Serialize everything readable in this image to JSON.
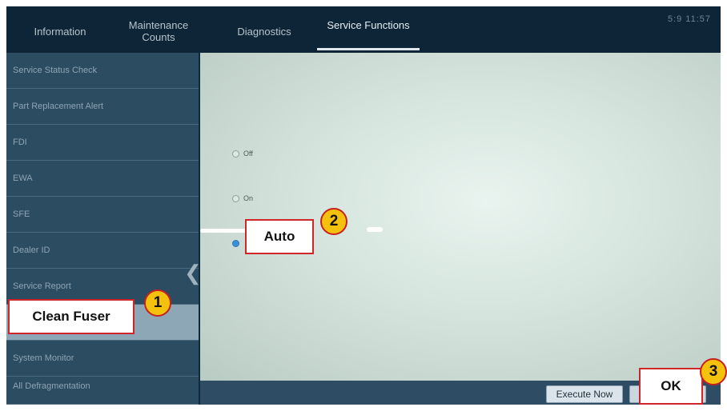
{
  "tabs": [
    {
      "label": "Information",
      "active": false
    },
    {
      "label": "Maintenance Counts",
      "active": false
    },
    {
      "label": "Diagnostics",
      "active": false
    },
    {
      "label": "Service Functions",
      "active": true
    }
  ],
  "clock": "5:9 11:57",
  "sidebar": {
    "items": [
      {
        "label": "Service Status Check",
        "selected": false
      },
      {
        "label": "Part Replacement Alert",
        "selected": false
      },
      {
        "label": "FDI",
        "selected": false
      },
      {
        "label": "EWA",
        "selected": false
      },
      {
        "label": "SFE",
        "selected": false
      },
      {
        "label": "Dealer ID",
        "selected": false
      },
      {
        "label": "Service Report",
        "selected": false
      },
      {
        "label": "Clean Fuser",
        "selected": true
      },
      {
        "label": "System Monitor",
        "selected": false
      },
      {
        "label": "All Defragmentation",
        "selected": false
      }
    ]
  },
  "options": [
    {
      "label": "Off",
      "checked": false
    },
    {
      "label": "On",
      "checked": false
    },
    {
      "label": "Auto",
      "checked": true
    }
  ],
  "buttons": {
    "execute_now": "Execute Now",
    "ok": "OK"
  },
  "callouts": [
    {
      "text": "Clean Fuser",
      "badge": "1"
    },
    {
      "text": "Auto",
      "badge": "2"
    },
    {
      "text": "OK",
      "badge": "3"
    }
  ],
  "colors": {
    "accent": "#d0262a",
    "badge": "#f4c20d",
    "radio_selected": "#3a8fd6"
  }
}
